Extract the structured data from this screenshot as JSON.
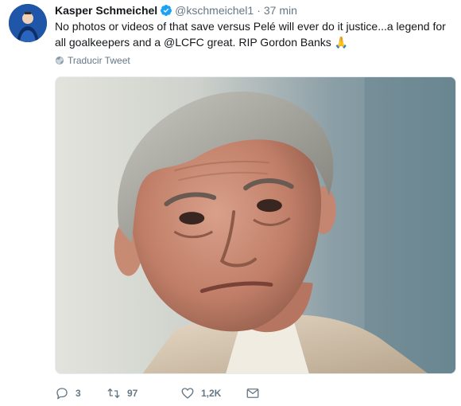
{
  "tweet": {
    "author_name": "Kasper Schmeichel",
    "handle": "@kschmeichel1",
    "separator": "·",
    "time": "37 min",
    "text": "No photos or videos of that save versus Pelé will ever do it justice...a legend for all goalkeepers and a @LCFC great. RIP Gordon Banks",
    "emoji": "🙏",
    "translate_label": "Traducir Tweet"
  },
  "actions": {
    "replies": "3",
    "retweets": "97",
    "likes": "1,2K"
  },
  "icons": {
    "avatar": "profile-avatar",
    "verified": "verified-badge-icon",
    "translate": "globe-icon",
    "reply": "reply-icon",
    "retweet": "retweet-icon",
    "like": "heart-icon",
    "dm": "envelope-icon"
  },
  "colors": {
    "verified_blue": "#1da1f2",
    "text": "#14171a",
    "secondary_text": "#657786"
  }
}
